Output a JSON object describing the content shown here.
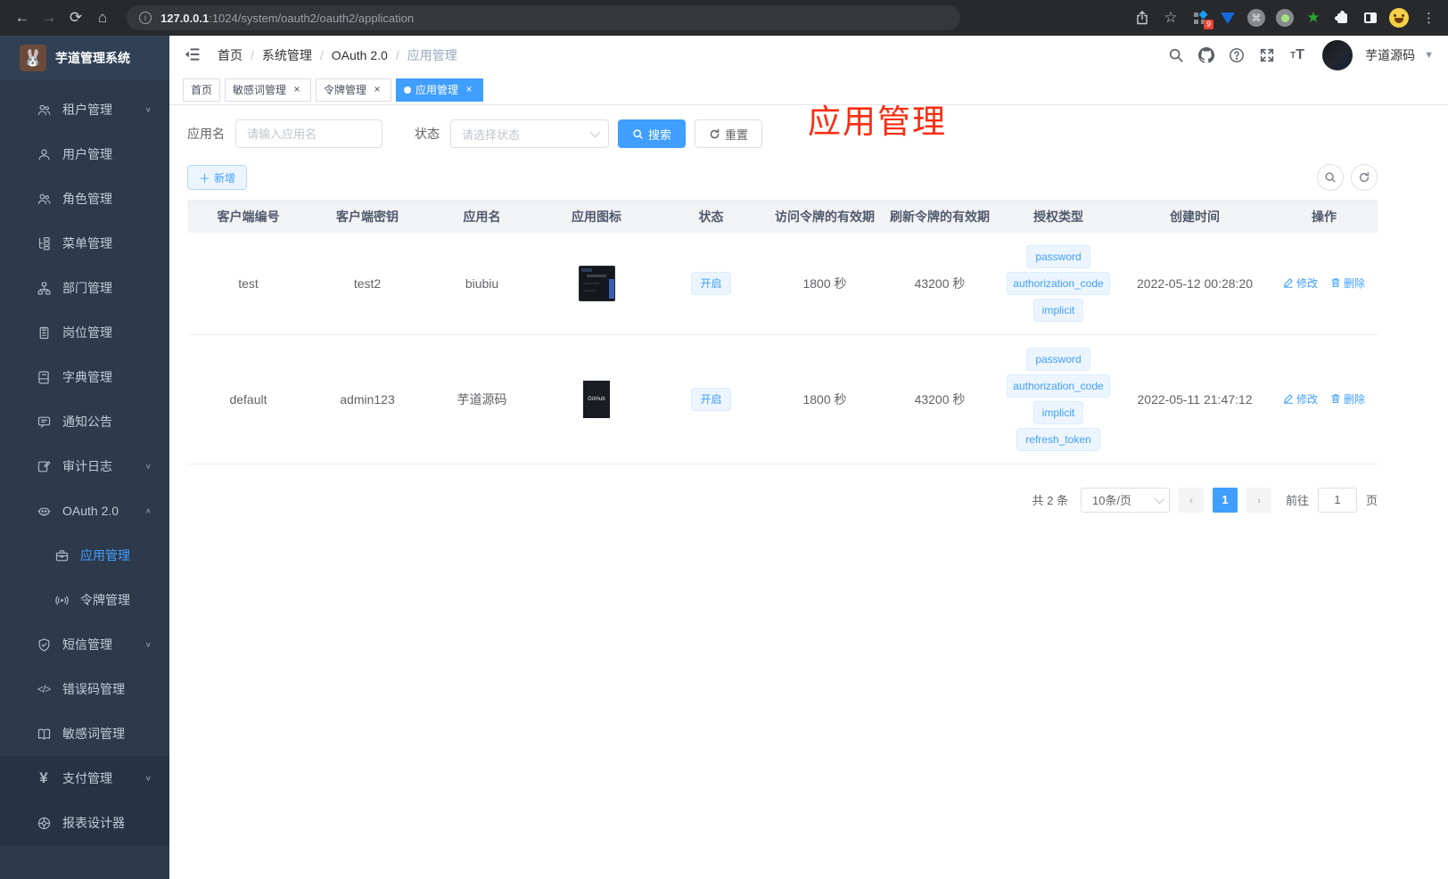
{
  "browser": {
    "url_host": "127.0.0.1",
    "url_rest": ":1024/system/oauth2/oauth2/application",
    "extension_badge": "9"
  },
  "sidebar": {
    "app_title": "芋道管理系统",
    "items": [
      {
        "label": "租户管理",
        "icon": "users",
        "arrow": "down"
      },
      {
        "label": "用户管理",
        "icon": "user"
      },
      {
        "label": "角色管理",
        "icon": "users"
      },
      {
        "label": "菜单管理",
        "icon": "tree"
      },
      {
        "label": "部门管理",
        "icon": "org"
      },
      {
        "label": "岗位管理",
        "icon": "badge"
      },
      {
        "label": "字典管理",
        "icon": "dict"
      },
      {
        "label": "通知公告",
        "icon": "notice"
      },
      {
        "label": "审计日志",
        "icon": "log",
        "arrow": "down"
      },
      {
        "label": "OAuth 2.0",
        "icon": "robot",
        "arrow": "up"
      },
      {
        "label": "应用管理",
        "icon": "briefcase",
        "sub": true,
        "active": true
      },
      {
        "label": "令牌管理",
        "icon": "signal",
        "sub": true
      },
      {
        "label": "短信管理",
        "icon": "shield",
        "arrow": "down"
      },
      {
        "label": "错误码管理",
        "icon": "code"
      },
      {
        "label": "敏感词管理",
        "icon": "bookopen"
      },
      {
        "label": "支付管理",
        "icon": "yen",
        "arrow": "down",
        "section": "bottom"
      },
      {
        "label": "报表设计器",
        "icon": "report",
        "section": "bottom"
      }
    ]
  },
  "navbar": {
    "breadcrumb": [
      "首页",
      "系统管理",
      "OAuth 2.0",
      "应用管理"
    ],
    "username": "芋道源码"
  },
  "tabs": [
    {
      "label": "首页",
      "closable": false,
      "active": false
    },
    {
      "label": "敏感词管理",
      "closable": true,
      "active": false
    },
    {
      "label": "令牌管理",
      "closable": true,
      "active": false
    },
    {
      "label": "应用管理",
      "closable": true,
      "active": true
    }
  ],
  "annotation": {
    "text": "应用管理",
    "color": "#fb2d12"
  },
  "filter": {
    "name_label": "应用名",
    "name_placeholder": "请输入应用名",
    "status_label": "状态",
    "status_placeholder": "请选择状态",
    "search_label": "搜索",
    "reset_label": "重置"
  },
  "toolbar": {
    "add_label": "新增"
  },
  "table": {
    "headers": [
      "客户端编号",
      "客户端密钥",
      "应用名",
      "应用图标",
      "状态",
      "访问令牌的有效期",
      "刷新令牌的有效期",
      "授权类型",
      "创建时间",
      "操作"
    ],
    "actions": {
      "edit": "修改",
      "delete": "删除"
    },
    "rows": [
      {
        "client_id": "test",
        "secret": "test2",
        "name": "biubiu",
        "icon_type": "screenshot",
        "icon_text": "",
        "status": "开启",
        "access_ttl": "1800 秒",
        "refresh_ttl": "43200 秒",
        "grants": [
          "password",
          "authorization_code",
          "implicit"
        ],
        "created": "2022-05-12 00:28:20"
      },
      {
        "client_id": "default",
        "secret": "admin123",
        "name": "芋道源码",
        "icon_type": "github",
        "icon_text": "GitHub",
        "status": "开启",
        "access_ttl": "1800 秒",
        "refresh_ttl": "43200 秒",
        "grants": [
          "password",
          "authorization_code",
          "implicit",
          "refresh_token"
        ],
        "created": "2022-05-11 21:47:12"
      }
    ]
  },
  "pagination": {
    "total_label": "共 2 条",
    "size_label": "10条/页",
    "current_page": "1",
    "goto_label": "前往",
    "goto_value": "1",
    "unit_label": "页"
  },
  "colors": {
    "primary": "#409EFF",
    "tag_bg": "#ecf5ff",
    "annotation": "#fb2d12"
  }
}
